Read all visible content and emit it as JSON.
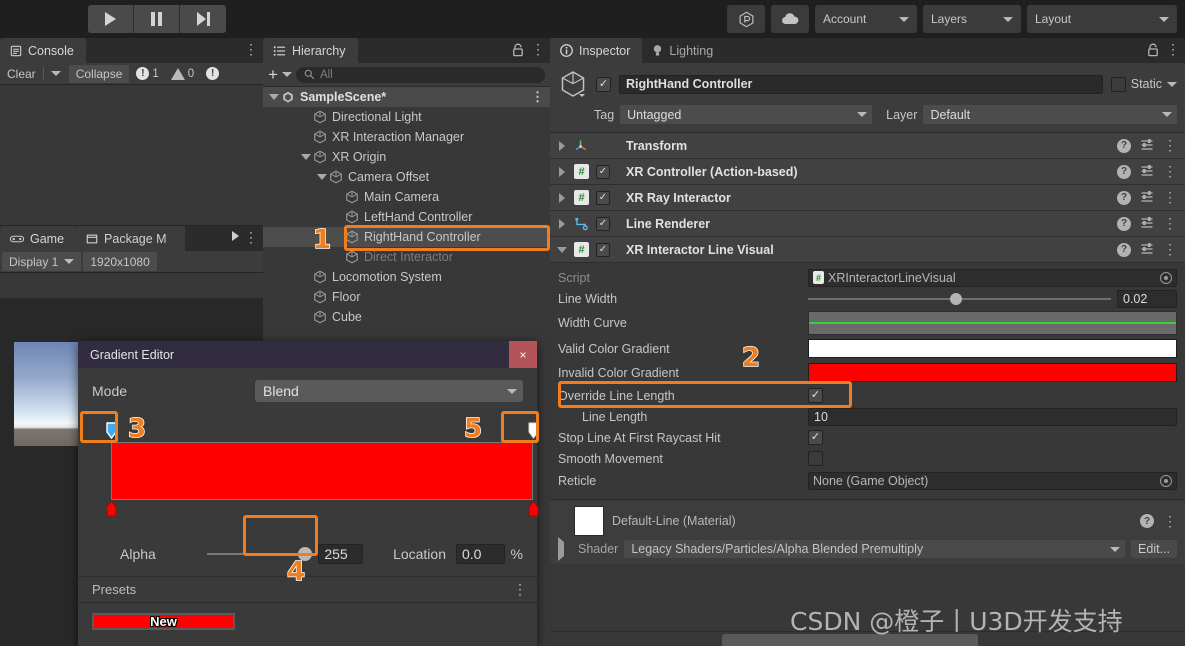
{
  "toolbar": {
    "play_label": "play-icon",
    "pause_label": "pause-icon",
    "step_label": "step-icon",
    "collab_icon": "collab-icon",
    "cloud_icon": "cloud-icon",
    "account_label": "Account",
    "layers_label": "Layers",
    "layout_label": "Layout"
  },
  "console": {
    "tab_label": "Console",
    "clear_label": "Clear",
    "collapse_label": "Collapse",
    "error_count": "1",
    "warning_count": "0"
  },
  "game": {
    "tab_label": "Game",
    "package_tab_label": "Package M",
    "display_label": "Display 1",
    "resolution_label": "1920x1080"
  },
  "hierarchy": {
    "tab_label": "Hierarchy",
    "search_placeholder": "All",
    "items": [
      {
        "label": "SampleScene*",
        "depth": 0,
        "icon": "unity-icon",
        "expanded": true,
        "state": "scene"
      },
      {
        "label": "Directional Light",
        "depth": 2,
        "icon": "cube-icon",
        "state": "normal"
      },
      {
        "label": "XR Interaction Manager",
        "depth": 2,
        "icon": "cube-icon",
        "state": "normal"
      },
      {
        "label": "XR Origin",
        "depth": 2,
        "icon": "cube-icon",
        "expanded": true,
        "state": "normal"
      },
      {
        "label": "Camera Offset",
        "depth": 3,
        "icon": "cube-icon",
        "expanded": true,
        "state": "normal"
      },
      {
        "label": "Main Camera",
        "depth": 4,
        "icon": "cube-icon",
        "state": "normal"
      },
      {
        "label": "LeftHand Controller",
        "depth": 4,
        "icon": "cube-icon",
        "state": "normal"
      },
      {
        "label": "RightHand Controller",
        "depth": 4,
        "icon": "cube-icon",
        "state": "selected"
      },
      {
        "label": "Direct Interactor",
        "depth": 4,
        "icon": "cube-icon",
        "state": "dim"
      },
      {
        "label": "Locomotion System",
        "depth": 2,
        "icon": "cube-icon",
        "state": "normal"
      },
      {
        "label": "Floor",
        "depth": 2,
        "icon": "cube-icon",
        "state": "normal"
      },
      {
        "label": "Cube",
        "depth": 2,
        "icon": "cube-icon",
        "state": "normal"
      }
    ]
  },
  "inspector": {
    "tab_label": "Inspector",
    "lighting_tab_label": "Lighting",
    "object_name": "RightHand Controller",
    "static_label": "Static",
    "tag_label": "Tag",
    "tag_value": "Untagged",
    "layer_label": "Layer",
    "layer_value": "Default",
    "components": [
      {
        "title": "Transform",
        "icon": "transform-icon",
        "expanded": false,
        "has_enable": false
      },
      {
        "title": "XR Controller (Action-based)",
        "icon": "script-icon",
        "expanded": false,
        "has_enable": true
      },
      {
        "title": "XR Ray Interactor",
        "icon": "script-icon",
        "expanded": false,
        "has_enable": true
      },
      {
        "title": "Line Renderer",
        "icon": "line-renderer-icon",
        "expanded": false,
        "has_enable": true
      },
      {
        "title": "XR Interactor Line Visual",
        "icon": "script-icon",
        "expanded": true,
        "has_enable": true
      }
    ],
    "props": {
      "script_label": "Script",
      "script_value": "XRInteractorLineVisual",
      "line_width_label": "Line Width",
      "line_width_value": "0.02",
      "width_curve_label": "Width Curve",
      "valid_color_gradient_label": "Valid Color Gradient",
      "valid_color_gradient_color": "#ffffff",
      "invalid_color_gradient_label": "Invalid Color Gradient",
      "invalid_color_gradient_color": "#ff0000",
      "override_line_length_label": "Override Line Length",
      "override_line_length_value": "✓",
      "line_length_label": "Line Length",
      "line_length_value": "10",
      "stop_line_label": "Stop Line At First Raycast Hit",
      "stop_line_value": "✓",
      "smooth_movement_label": "Smooth Movement",
      "reticle_label": "Reticle",
      "reticle_value": "None (Game Object)"
    },
    "material": {
      "title": "Default-Line (Material)",
      "shader_label": "Shader",
      "shader_value": "Legacy Shaders/Particles/Alpha Blended Premultiply",
      "edit_label": "Edit..."
    }
  },
  "gradient_editor": {
    "title": "Gradient Editor",
    "close_label": "×",
    "mode_label": "Mode",
    "mode_value": "Blend",
    "gradient_color": "#ff0000",
    "alpha_label": "Alpha",
    "alpha_value": "255",
    "location_label": "Location",
    "location_value": "0.0",
    "percent_label": "%",
    "presets_label": "Presets",
    "preset_name": "New",
    "preset_color": "#ff0000"
  },
  "callouts": {
    "one": "1",
    "two": "2",
    "three": "3",
    "four": "4",
    "five": "5"
  },
  "watermark": "CSDN @橙子丨U3D开发支持",
  "colors": {
    "accent_orange": "#f07d1e",
    "red": "#ff0000",
    "panel_bg": "#383838",
    "header_bg": "#3c3c3c"
  }
}
